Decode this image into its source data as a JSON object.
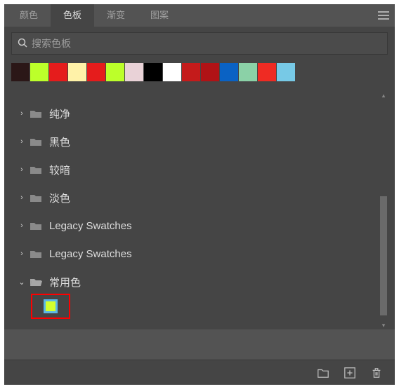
{
  "tabs": {
    "color": "颜色",
    "swatches": "色板",
    "gradient": "渐变",
    "pattern": "图案"
  },
  "search": {
    "placeholder": "搜索色板"
  },
  "recent_swatches": [
    "#2b1717",
    "#bcff2a",
    "#e51c1c",
    "#fff2a8",
    "#e51c1c",
    "#bcff2a",
    "#e9d2d7",
    "#000000",
    "#ffffff",
    "#c41b1b",
    "#b01316",
    "#0a62c4",
    "#8bd1a7",
    "#ef2b23",
    "#77c9e6"
  ],
  "folders": [
    {
      "label": "纯净",
      "expanded": false
    },
    {
      "label": "黑色",
      "expanded": false
    },
    {
      "label": "较暗",
      "expanded": false
    },
    {
      "label": "淡色",
      "expanded": false
    },
    {
      "label": "Legacy Swatches",
      "expanded": false
    },
    {
      "label": "Legacy Swatches",
      "expanded": false
    },
    {
      "label": "常用色",
      "expanded": true
    }
  ]
}
